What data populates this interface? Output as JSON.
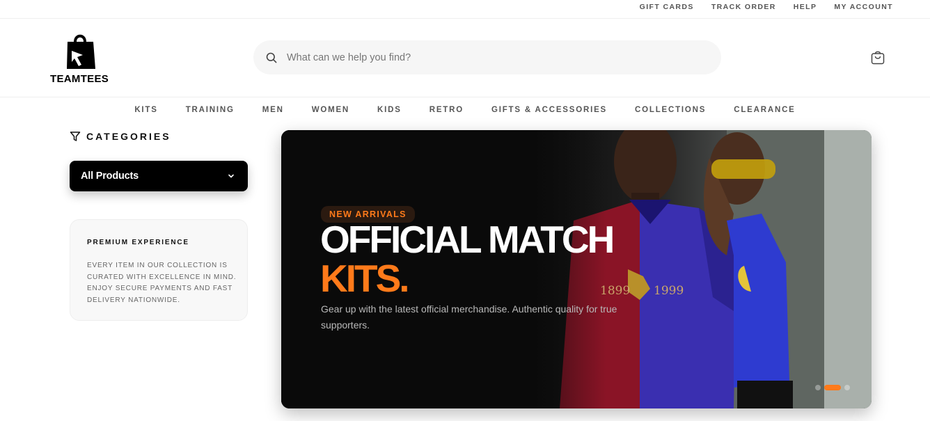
{
  "top_links": [
    "GIFT CARDS",
    "TRACK ORDER",
    "HELP",
    "MY ACCOUNT"
  ],
  "brand": {
    "name": "TEAMTEES"
  },
  "search": {
    "placeholder": "What can we help you find?"
  },
  "nav": [
    "KITS",
    "TRAINING",
    "MEN",
    "WOMEN",
    "KIDS",
    "RETRO",
    "GIFTS & ACCESSORIES",
    "COLLECTIONS",
    "CLEARANCE"
  ],
  "sidebar": {
    "categories_title": "CATEGORIES",
    "dropdown_value": "All Products",
    "promo_title": "PREMIUM EXPERIENCE",
    "promo_text": "Every item in our collection is curated with excellence in mind. Enjoy secure payments and fast delivery nationwide."
  },
  "hero": {
    "badge": "NEW ARRIVALS",
    "title_line1": "OFFICIAL MATCH",
    "title_line2": "KITS.",
    "subtitle": "Gear up with the latest official merchandise. Authentic quality for true supporters.",
    "slides": 3,
    "active_slide": 2,
    "jersey_text_left": "1899",
    "jersey_text_right": "1999"
  },
  "colors": {
    "accent": "#ff7a1a",
    "dark": "#000000"
  },
  "icons": [
    "search-icon",
    "cart-icon",
    "filter-icon",
    "chevron-down-icon"
  ]
}
